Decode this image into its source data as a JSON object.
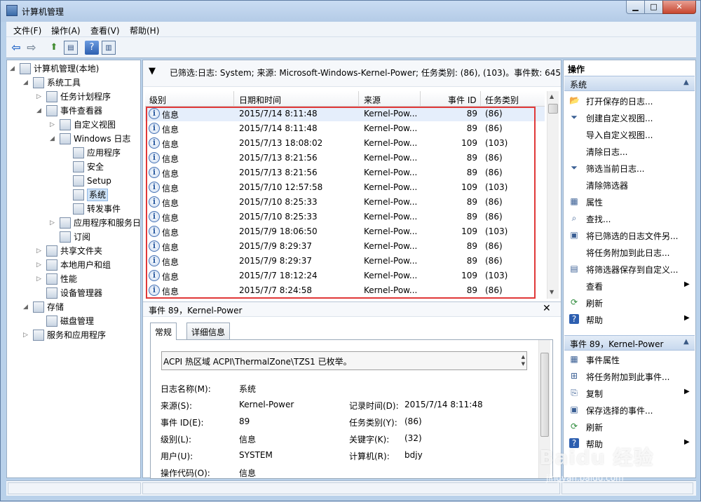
{
  "window": {
    "title": "计算机管理"
  },
  "menu": [
    "文件(F)",
    "操作(A)",
    "查看(V)",
    "帮助(H)"
  ],
  "tree": [
    {
      "label": "计算机管理(本地)",
      "level": 0,
      "expanded": true
    },
    {
      "label": "系统工具",
      "level": 1,
      "expanded": true
    },
    {
      "label": "任务计划程序",
      "level": 2,
      "expanded": false
    },
    {
      "label": "事件查看器",
      "level": 2,
      "expanded": true
    },
    {
      "label": "自定义视图",
      "level": 3,
      "expanded": false
    },
    {
      "label": "Windows 日志",
      "level": 3,
      "expanded": true
    },
    {
      "label": "应用程序",
      "level": 4
    },
    {
      "label": "安全",
      "level": 4
    },
    {
      "label": "Setup",
      "level": 4
    },
    {
      "label": "系统",
      "level": 4,
      "selected": true
    },
    {
      "label": "转发事件",
      "level": 4
    },
    {
      "label": "应用程序和服务日志",
      "level": 3,
      "expanded": false
    },
    {
      "label": "订阅",
      "level": 3
    },
    {
      "label": "共享文件夹",
      "level": 2,
      "expanded": false
    },
    {
      "label": "本地用户和组",
      "level": 2,
      "expanded": false
    },
    {
      "label": "性能",
      "level": 2,
      "expanded": false
    },
    {
      "label": "设备管理器",
      "level": 2
    },
    {
      "label": "存储",
      "level": 1,
      "expanded": true
    },
    {
      "label": "磁盘管理",
      "level": 2
    },
    {
      "label": "服务和应用程序",
      "level": 1,
      "expanded": false
    }
  ],
  "filter_text": "已筛选:日志: System; 来源: Microsoft-Windows-Kernel-Power; 任务类别: (86), (103)。事件数: 645",
  "columns": [
    "级别",
    "日期和时间",
    "来源",
    "事件 ID",
    "任务类别"
  ],
  "events": [
    {
      "level": "信息",
      "datetime": "2015/7/14 8:11:48",
      "source": "Kernel-Pow...",
      "id": "89",
      "category": "(86)"
    },
    {
      "level": "信息",
      "datetime": "2015/7/14 8:11:48",
      "source": "Kernel-Pow...",
      "id": "89",
      "category": "(86)"
    },
    {
      "level": "信息",
      "datetime": "2015/7/13 18:08:02",
      "source": "Kernel-Pow...",
      "id": "109",
      "category": "(103)"
    },
    {
      "level": "信息",
      "datetime": "2015/7/13 8:21:56",
      "source": "Kernel-Pow...",
      "id": "89",
      "category": "(86)"
    },
    {
      "level": "信息",
      "datetime": "2015/7/13 8:21:56",
      "source": "Kernel-Pow...",
      "id": "89",
      "category": "(86)"
    },
    {
      "level": "信息",
      "datetime": "2015/7/10 12:57:58",
      "source": "Kernel-Pow...",
      "id": "109",
      "category": "(103)"
    },
    {
      "level": "信息",
      "datetime": "2015/7/10 8:25:33",
      "source": "Kernel-Pow...",
      "id": "89",
      "category": "(86)"
    },
    {
      "level": "信息",
      "datetime": "2015/7/10 8:25:33",
      "source": "Kernel-Pow...",
      "id": "89",
      "category": "(86)"
    },
    {
      "level": "信息",
      "datetime": "2015/7/9 18:06:50",
      "source": "Kernel-Pow...",
      "id": "109",
      "category": "(103)"
    },
    {
      "level": "信息",
      "datetime": "2015/7/9 8:29:37",
      "source": "Kernel-Pow...",
      "id": "89",
      "category": "(86)"
    },
    {
      "level": "信息",
      "datetime": "2015/7/9 8:29:37",
      "source": "Kernel-Pow...",
      "id": "89",
      "category": "(86)"
    },
    {
      "level": "信息",
      "datetime": "2015/7/7 18:12:24",
      "source": "Kernel-Pow...",
      "id": "109",
      "category": "(103)"
    },
    {
      "level": "信息",
      "datetime": "2015/7/7 8:24:58",
      "source": "Kernel-Pow...",
      "id": "89",
      "category": "(86)"
    }
  ],
  "detail": {
    "title": "事件 89，Kernel-Power",
    "tabs": [
      "常规",
      "详细信息"
    ],
    "description": "ACPI 热区域 ACPI\\ThermalZone\\TZS1 已枚举。",
    "fields": {
      "log_name_label": "日志名称(M):",
      "log_name": "系统",
      "source_label": "来源(S):",
      "source": "Kernel-Power",
      "logged_label": "记录时间(D):",
      "logged": "2015/7/14 8:11:48",
      "event_id_label": "事件 ID(E):",
      "event_id": "89",
      "task_label": "任务类别(Y):",
      "task": "(86)",
      "level_label": "级别(L):",
      "level": "信息",
      "keywords_label": "关键字(K):",
      "keywords": "(32)",
      "user_label": "用户(U):",
      "user": "SYSTEM",
      "computer_label": "计算机(R):",
      "computer": "bdjy",
      "opcode_label": "操作代码(O):",
      "opcode": "信息"
    }
  },
  "actions": {
    "title": "操作",
    "section1": "系统",
    "items1": [
      {
        "label": "打开保存的日志...",
        "icon": "folder-icon"
      },
      {
        "label": "创建自定义视图...",
        "icon": "filter-icon"
      },
      {
        "label": "导入自定义视图...",
        "icon": ""
      },
      {
        "label": "清除日志...",
        "icon": ""
      },
      {
        "label": "筛选当前日志...",
        "icon": "filter-icon"
      },
      {
        "label": "清除筛选器",
        "icon": ""
      },
      {
        "label": "属性",
        "icon": "properties-icon"
      },
      {
        "label": "查找...",
        "icon": "find-icon"
      },
      {
        "label": "将已筛选的日志文件另...",
        "icon": "save-icon"
      },
      {
        "label": "将任务附加到此日志...",
        "icon": ""
      },
      {
        "label": "将筛选器保存到自定义...",
        "icon": "save-filter-icon"
      },
      {
        "label": "查看",
        "icon": "",
        "submenu": true
      },
      {
        "label": "刷新",
        "icon": "refresh-icon"
      },
      {
        "label": "帮助",
        "icon": "help-icon",
        "submenu": true
      }
    ],
    "section2": "事件 89，Kernel-Power",
    "items2": [
      {
        "label": "事件属性",
        "icon": "properties-icon"
      },
      {
        "label": "将任务附加到此事件...",
        "icon": "task-icon"
      },
      {
        "label": "复制",
        "icon": "copy-icon",
        "submenu": true
      },
      {
        "label": "保存选择的事件...",
        "icon": "save-icon"
      },
      {
        "label": "刷新",
        "icon": "refresh-icon"
      },
      {
        "label": "帮助",
        "icon": "help-icon",
        "submenu": true
      }
    ]
  },
  "watermark": {
    "logo": "Baidu 经验",
    "site": "jingyan.baidu.com"
  }
}
